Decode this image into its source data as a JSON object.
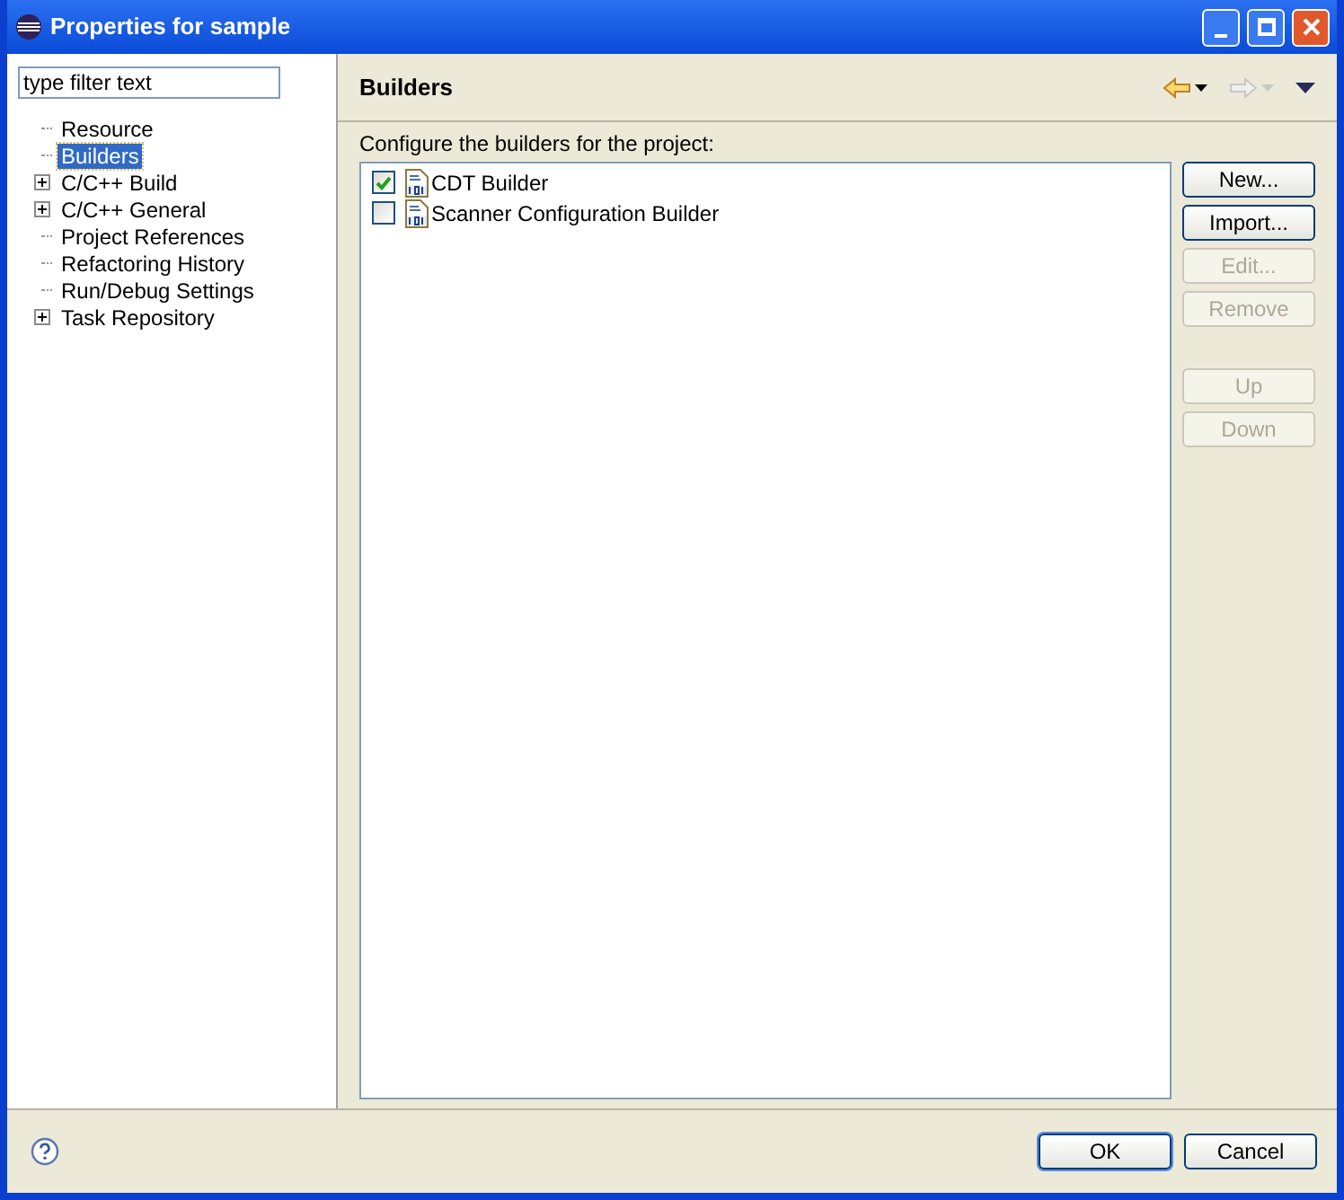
{
  "window": {
    "title": "Properties for sample"
  },
  "filter": {
    "placeholder": "type filter text"
  },
  "tree": [
    {
      "label": "Resource",
      "kind": "leaf",
      "selected": false
    },
    {
      "label": "Builders",
      "kind": "leaf",
      "selected": true
    },
    {
      "label": "C/C++ Build",
      "kind": "collapsed",
      "selected": false
    },
    {
      "label": "C/C++ General",
      "kind": "collapsed",
      "selected": false
    },
    {
      "label": "Project References",
      "kind": "leaf",
      "selected": false
    },
    {
      "label": "Refactoring History",
      "kind": "leaf",
      "selected": false
    },
    {
      "label": "Run/Debug Settings",
      "kind": "leaf",
      "selected": false
    },
    {
      "label": "Task Repository",
      "kind": "collapsed",
      "selected": false
    }
  ],
  "page": {
    "title": "Builders",
    "description": "Configure the builders for the project:"
  },
  "builders": [
    {
      "name": "CDT Builder",
      "checked": true
    },
    {
      "name": "Scanner Configuration Builder",
      "checked": false
    }
  ],
  "side_button_groups": [
    [
      {
        "label": "New...",
        "disabled": false
      },
      {
        "label": "Import...",
        "disabled": false
      },
      {
        "label": "Edit...",
        "disabled": true
      },
      {
        "label": "Remove",
        "disabled": true
      }
    ],
    [
      {
        "label": "Up",
        "disabled": true
      },
      {
        "label": "Down",
        "disabled": true
      }
    ]
  ],
  "footer_buttons": [
    {
      "label": "OK",
      "default": true
    },
    {
      "label": "Cancel",
      "default": false
    }
  ]
}
